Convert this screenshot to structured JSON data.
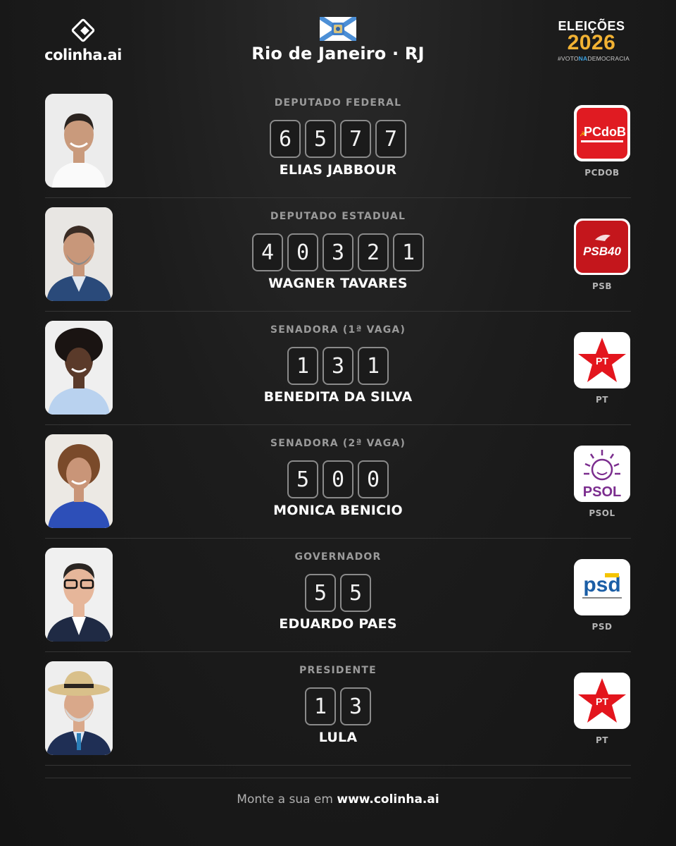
{
  "brand": {
    "name": "colinha.ai"
  },
  "header": {
    "state": "Rio de Janeiro · RJ"
  },
  "badge": {
    "title": "ELEIÇÕES",
    "year": "2026",
    "tag_pre": "#VOTO",
    "tag_mid": "NA",
    "tag_post": "DEMOCRACIA"
  },
  "rows": [
    {
      "office": "DEPUTADO FEDERAL",
      "digits": [
        "6",
        "5",
        "7",
        "7"
      ],
      "candidate": "ELIAS JABBOUR",
      "party": "PCDOB",
      "party_logo_text": "PCdoB",
      "party_color": "#e01b22"
    },
    {
      "office": "DEPUTADO ESTADUAL",
      "digits": [
        "4",
        "0",
        "3",
        "2",
        "1"
      ],
      "candidate": "WAGNER TAVARES",
      "party": "PSB",
      "party_logo_text": "PSB40",
      "party_color": "#c4161c"
    },
    {
      "office": "SENADORA (1ª VAGA)",
      "digits": [
        "1",
        "3",
        "1"
      ],
      "candidate": "BENEDITA DA SILVA",
      "party": "PT",
      "party_logo_text": "PT",
      "party_color": "#e3151d"
    },
    {
      "office": "SENADORA (2ª VAGA)",
      "digits": [
        "5",
        "0",
        "0"
      ],
      "candidate": "MONICA BENICIO",
      "party": "PSOL",
      "party_logo_text": "PSOL",
      "party_color": "#7b2d8e"
    },
    {
      "office": "GOVERNADOR",
      "digits": [
        "5",
        "5"
      ],
      "candidate": "EDUARDO PAES",
      "party": "PSD",
      "party_logo_text": "psd",
      "party_color": "#1b5ea6"
    },
    {
      "office": "PRESIDENTE",
      "digits": [
        "1",
        "3"
      ],
      "candidate": "LULA",
      "party": "PT",
      "party_logo_text": "PT",
      "party_color": "#e3151d"
    }
  ],
  "footer": {
    "prefix": "Monte a sua em",
    "url": "www.colinha.ai"
  }
}
